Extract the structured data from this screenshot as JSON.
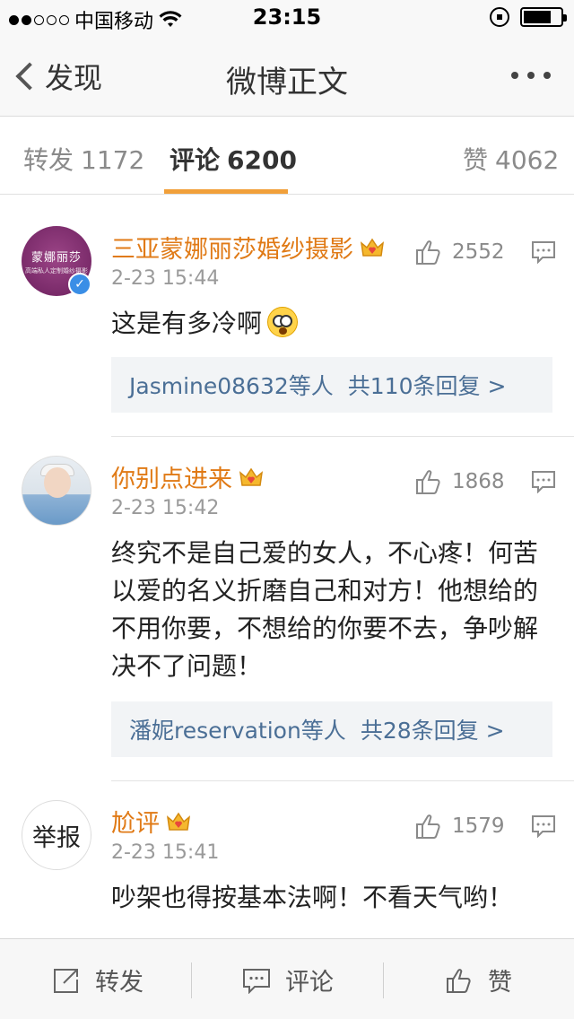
{
  "status_bar": {
    "carrier": "中国移动",
    "time": "23:15"
  },
  "nav": {
    "back_label": "发现",
    "title": "微博正文"
  },
  "tabs": [
    {
      "label": "转发",
      "count": "1172"
    },
    {
      "label": "评论",
      "count": "6200"
    },
    {
      "label": "赞",
      "count": "4062"
    }
  ],
  "comments": [
    {
      "name": "三亚蒙娜丽莎婚纱摄影",
      "avatar_text": "蒙娜丽莎",
      "avatar_subtext": "高端私人定制婚纱摄影",
      "time": "2-23 15:44",
      "likes": "2552",
      "text": "这是有多冷啊",
      "reply_who": "Jasmine08632等人",
      "reply_more": "共110条回复 >"
    },
    {
      "name": "你别点进来",
      "time": "2-23 15:42",
      "likes": "1868",
      "text": "终究不是自己爱的女人，不心疼！何苦以爱的名义折磨自己和对方！他想给的不用你要，不想给的你要不去，争吵解决不了问题！",
      "reply_who": "潘妮reservation等人",
      "reply_more": "共28条回复 >"
    },
    {
      "name": "尬评",
      "avatar_text": "举报",
      "time": "2-23 15:41",
      "likes": "1579",
      "text": "吵架也得按基本法啊！不看天气哟！"
    }
  ],
  "toolbar": {
    "repost": "转发",
    "comment": "评论",
    "like": "赞"
  },
  "colors": {
    "accent": "#f1a03a",
    "username": "#e07a16",
    "link": "#4b6f96"
  }
}
